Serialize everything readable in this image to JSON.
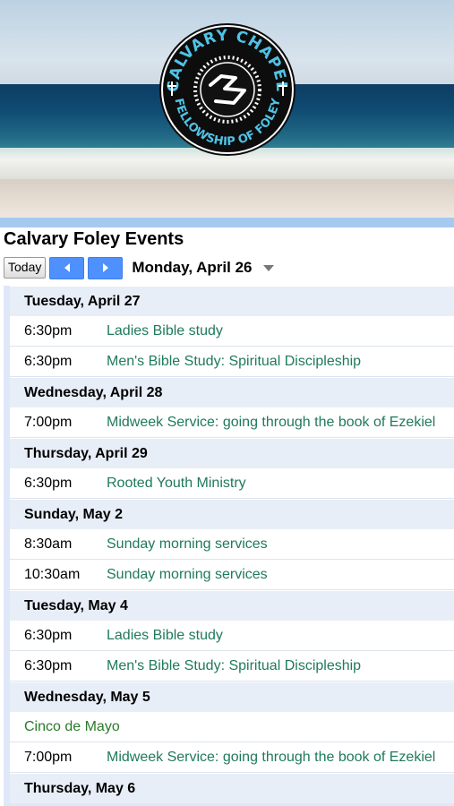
{
  "banner": {
    "logo": {
      "top_text": "CALVARY CHAPEL",
      "bottom_text": "FELLOWSHIP OF FOLEY"
    }
  },
  "calendar": {
    "title": "Calvary Foley Events",
    "today_label": "Today",
    "current_date": "Monday, April 26",
    "days": [
      {
        "date": "Tuesday, April 27",
        "events": [
          {
            "time": "6:30pm",
            "title": "Ladies Bible study"
          },
          {
            "time": "6:30pm",
            "title": "Men's Bible Study: Spiritual Discipleship"
          }
        ]
      },
      {
        "date": "Wednesday, April 28",
        "events": [
          {
            "time": "7:00pm",
            "title": "Midweek Service: going through the book of Ezekiel"
          }
        ]
      },
      {
        "date": "Thursday, April 29",
        "events": [
          {
            "time": "6:30pm",
            "title": "Rooted Youth Ministry"
          }
        ]
      },
      {
        "date": "Sunday, May 2",
        "events": [
          {
            "time": "8:30am",
            "title": "Sunday morning services"
          },
          {
            "time": "10:30am",
            "title": "Sunday morning services"
          }
        ]
      },
      {
        "date": "Tuesday, May 4",
        "events": [
          {
            "time": "6:30pm",
            "title": "Ladies Bible study"
          },
          {
            "time": "6:30pm",
            "title": "Men's Bible Study: Spiritual Discipleship"
          }
        ]
      },
      {
        "date": "Wednesday, May 5",
        "all_day": "Cinco de Mayo",
        "events": [
          {
            "time": "7:00pm",
            "title": "Midweek Service: going through the book of Ezekiel"
          }
        ]
      },
      {
        "date": "Thursday, May 6",
        "events": []
      }
    ]
  },
  "colors": {
    "accent": "#4d90fe",
    "event_title": "#1f7a5c",
    "all_day": "#2a7a2a"
  }
}
